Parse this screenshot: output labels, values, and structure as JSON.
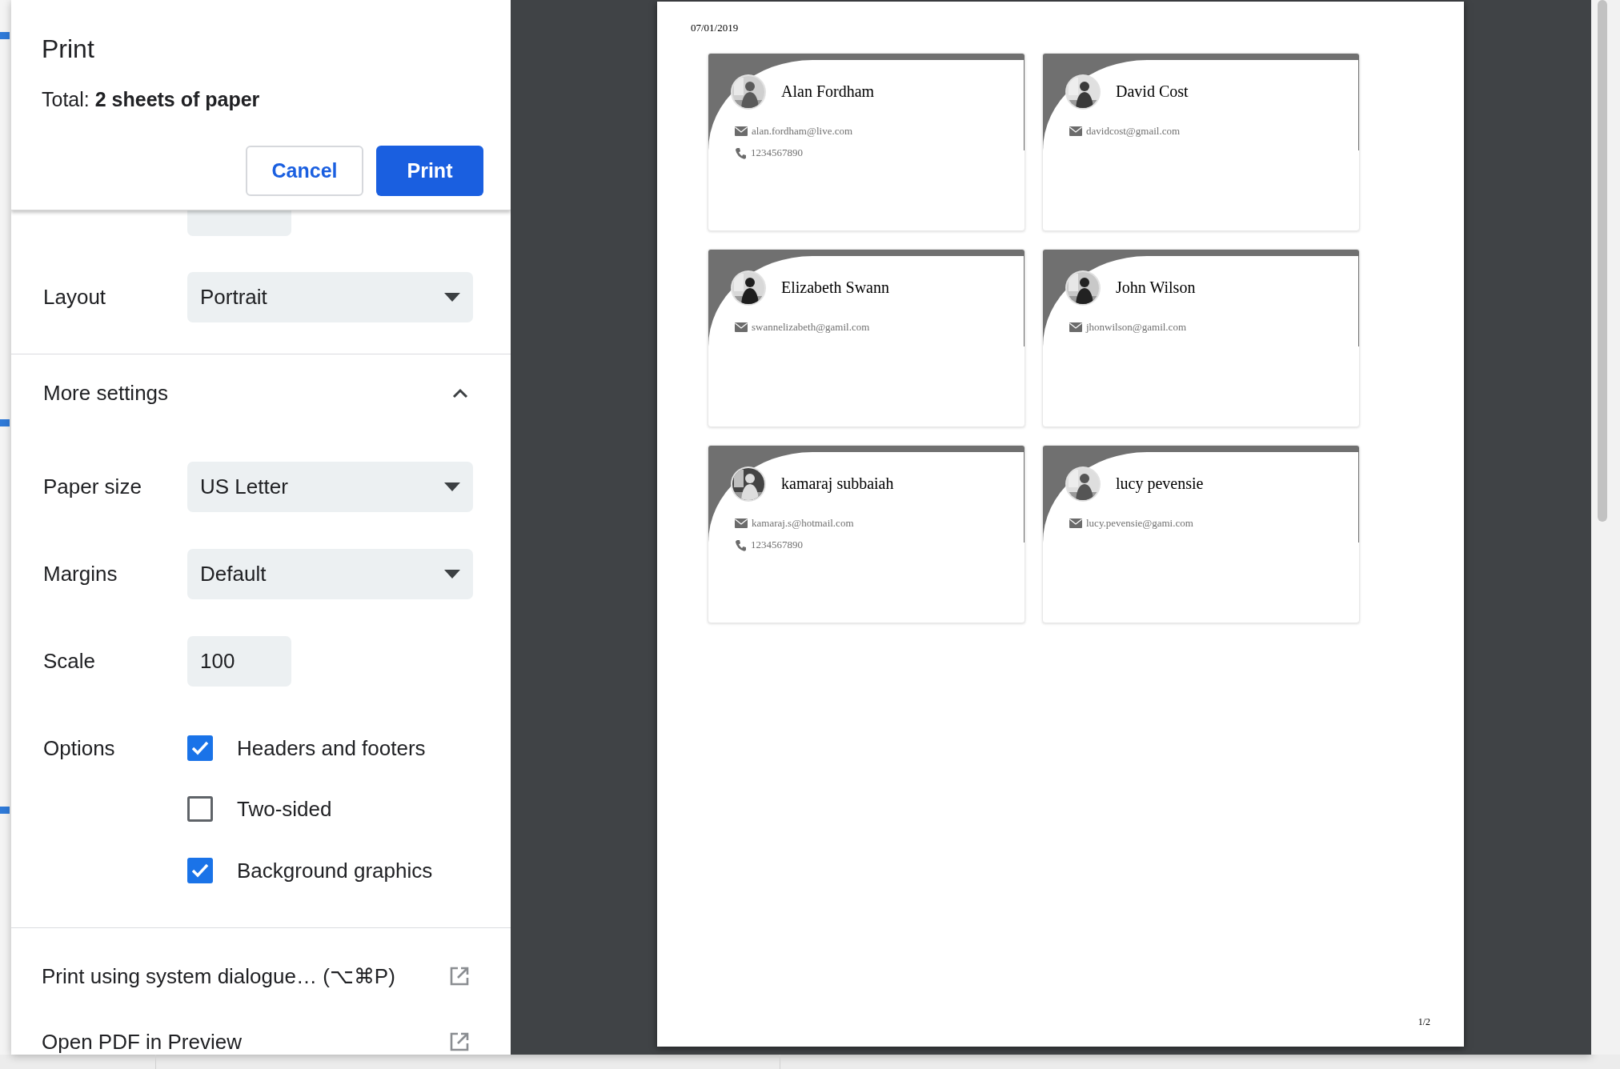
{
  "dialog": {
    "title": "Print",
    "total": "Total: **2 sheets of paper**",
    "buttons": [
      {
        "label": "Cancel",
        "kind": "secondary"
      },
      {
        "label": "Print",
        "kind": "primary"
      }
    ],
    "settings": [
      {
        "kind": "text"
      },
      {
        "label": "Layout",
        "kind": "select",
        "value": "Portrait"
      }
    ],
    "more_settings": {
      "label": "More settings",
      "expanded": true
    },
    "more": [
      {
        "label": "Paper size",
        "kind": "select",
        "value": "US Letter"
      },
      {
        "label": "Margins",
        "kind": "select",
        "value": "Default"
      },
      {
        "label": "Scale",
        "kind": "text",
        "value": "100"
      }
    ],
    "options": {
      "label": "Options",
      "items": [
        {
          "label": "Headers and footers",
          "checked": true
        },
        {
          "label": "Two-sided",
          "checked": false
        },
        {
          "label": "Background graphics",
          "checked": true
        }
      ]
    },
    "links": [
      {
        "label": "Print using system dialogue… (⌥⌘P)"
      },
      {
        "label": "Open PDF in Preview"
      }
    ]
  },
  "preview": {
    "date": "07/01/2019",
    "page_number": "1/2",
    "cards": [
      {
        "name": "Alan Fordham",
        "email": "alan.fordham@live.com",
        "phone": "1234567890"
      },
      {
        "name": "David Cost",
        "email": "davidcost@gmail.com"
      },
      {
        "name": "Elizabeth Swann",
        "email": "swannelizabeth@gamil.com"
      },
      {
        "name": "John Wilson",
        "email": "jhonwilson@gamil.com"
      },
      {
        "name": "kamaraj subbaiah",
        "email": "kamaraj.s@hotmail.com",
        "phone": "1234567890"
      },
      {
        "name": "lucy pevensie",
        "email": "lucy.pevensie@gami.com"
      }
    ]
  }
}
